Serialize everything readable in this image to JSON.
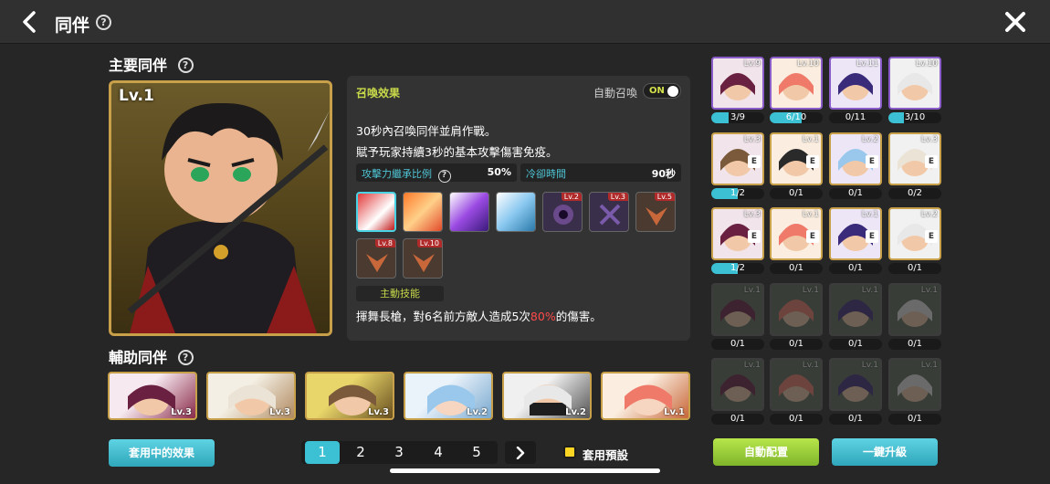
{
  "header": {
    "title": "同伴",
    "help": "?"
  },
  "main": {
    "section_label": "主要同伴",
    "help": "?",
    "level": "Lv.1"
  },
  "info": {
    "effect_title": "召喚效果",
    "auto_summon_label": "自動召喚",
    "auto_summon_state": "ON",
    "desc_line1": "30秒內召喚同伴並肩作戰。",
    "desc_line2": "賦予玩家持續3秒的基本攻擊傷害免疫。",
    "stat1_label": "攻擊力繼承比例",
    "stat1_help": "?",
    "stat1_value": "50%",
    "stat2_label": "冷卻時間",
    "stat2_value": "90秒",
    "skills": [
      {
        "icon": "slash-skill-icon",
        "level": ""
      },
      {
        "icon": "flame-skill-icon",
        "level": ""
      },
      {
        "icon": "spear-skill-icon",
        "level": ""
      },
      {
        "icon": "buff-up-skill-icon",
        "level": ""
      },
      {
        "icon": "dark-orb-skill-icon",
        "level": "Lv.2"
      },
      {
        "icon": "dark-rune-skill-icon",
        "level": "Lv.3"
      },
      {
        "icon": "fox-skill-icon",
        "level": "Lv.5"
      },
      {
        "icon": "fox-skill-icon",
        "level": "Lv.8"
      },
      {
        "icon": "fox-skill-icon",
        "level": "Lv.10"
      }
    ],
    "active_skill_tag": "主動技能",
    "skill_desc_pre": "揮舞長槍，對6名前方敵人造成5次",
    "skill_desc_pct": "80%",
    "skill_desc_post": "的傷害。"
  },
  "sub": {
    "section_label": "輔助同伴",
    "help": "?",
    "cards": [
      {
        "level": "Lv.3"
      },
      {
        "level": "Lv.3"
      },
      {
        "level": "Lv.3"
      },
      {
        "level": "Lv.2"
      },
      {
        "level": "Lv.2"
      },
      {
        "level": "Lv.1"
      }
    ]
  },
  "footer": {
    "applied_effects_button": "套用中的效果",
    "pages": [
      "1",
      "2",
      "3",
      "4",
      "5"
    ],
    "active_page": "1",
    "next": "›",
    "preset_label": "套用預設",
    "auto_config_button": "自動配置",
    "upgrade_all_button": "一鍵升級"
  },
  "roster": [
    [
      {
        "lv": "Lv.9",
        "count": "3/9",
        "progress": 0.33
      },
      {
        "lv": "Lv.10",
        "count": "6/10",
        "progress": 0.6
      },
      {
        "lv": "Lv.11",
        "count": "0/11",
        "progress": 0
      },
      {
        "lv": "Lv.10",
        "count": "3/10",
        "progress": 0.3
      }
    ],
    [
      {
        "lv": "Lv.3",
        "count": "1/2",
        "progress": 0.5,
        "e": "E"
      },
      {
        "lv": "Lv.1",
        "count": "0/1",
        "progress": 0,
        "e": "E"
      },
      {
        "lv": "Lv.2",
        "count": "0/1",
        "progress": 0,
        "e": "E"
      },
      {
        "lv": "Lv.3",
        "count": "0/2",
        "progress": 0,
        "e": "E"
      }
    ],
    [
      {
        "lv": "Lv.3",
        "count": "1/2",
        "progress": 0.5,
        "e": "E"
      },
      {
        "lv": "Lv.1",
        "count": "0/1",
        "progress": 0,
        "e": "E"
      },
      {
        "lv": "Lv.1",
        "count": "0/1",
        "progress": 0,
        "e": "E"
      },
      {
        "lv": "Lv.2",
        "count": "0/1",
        "progress": 0,
        "e": "E"
      }
    ],
    [
      {
        "lv": "Lv.1",
        "count": "0/1",
        "progress": 0
      },
      {
        "lv": "Lv.1",
        "count": "0/1",
        "progress": 0
      },
      {
        "lv": "Lv.1",
        "count": "0/1",
        "progress": 0
      },
      {
        "lv": "Lv.1",
        "count": "0/1",
        "progress": 0
      }
    ],
    [
      {
        "lv": "Lv.1",
        "count": "0/1",
        "progress": 0
      },
      {
        "lv": "Lv.1",
        "count": "0/1",
        "progress": 0
      },
      {
        "lv": "Lv.1",
        "count": "0/1",
        "progress": 0
      },
      {
        "lv": "Lv.1",
        "count": "0/1",
        "progress": 0
      }
    ]
  ],
  "colors": {
    "accent_teal": "#3cc0d3",
    "accent_green": "#9fd13a",
    "gold_frame": "#c9a04a",
    "purple_frame": "#8a5cc9"
  }
}
